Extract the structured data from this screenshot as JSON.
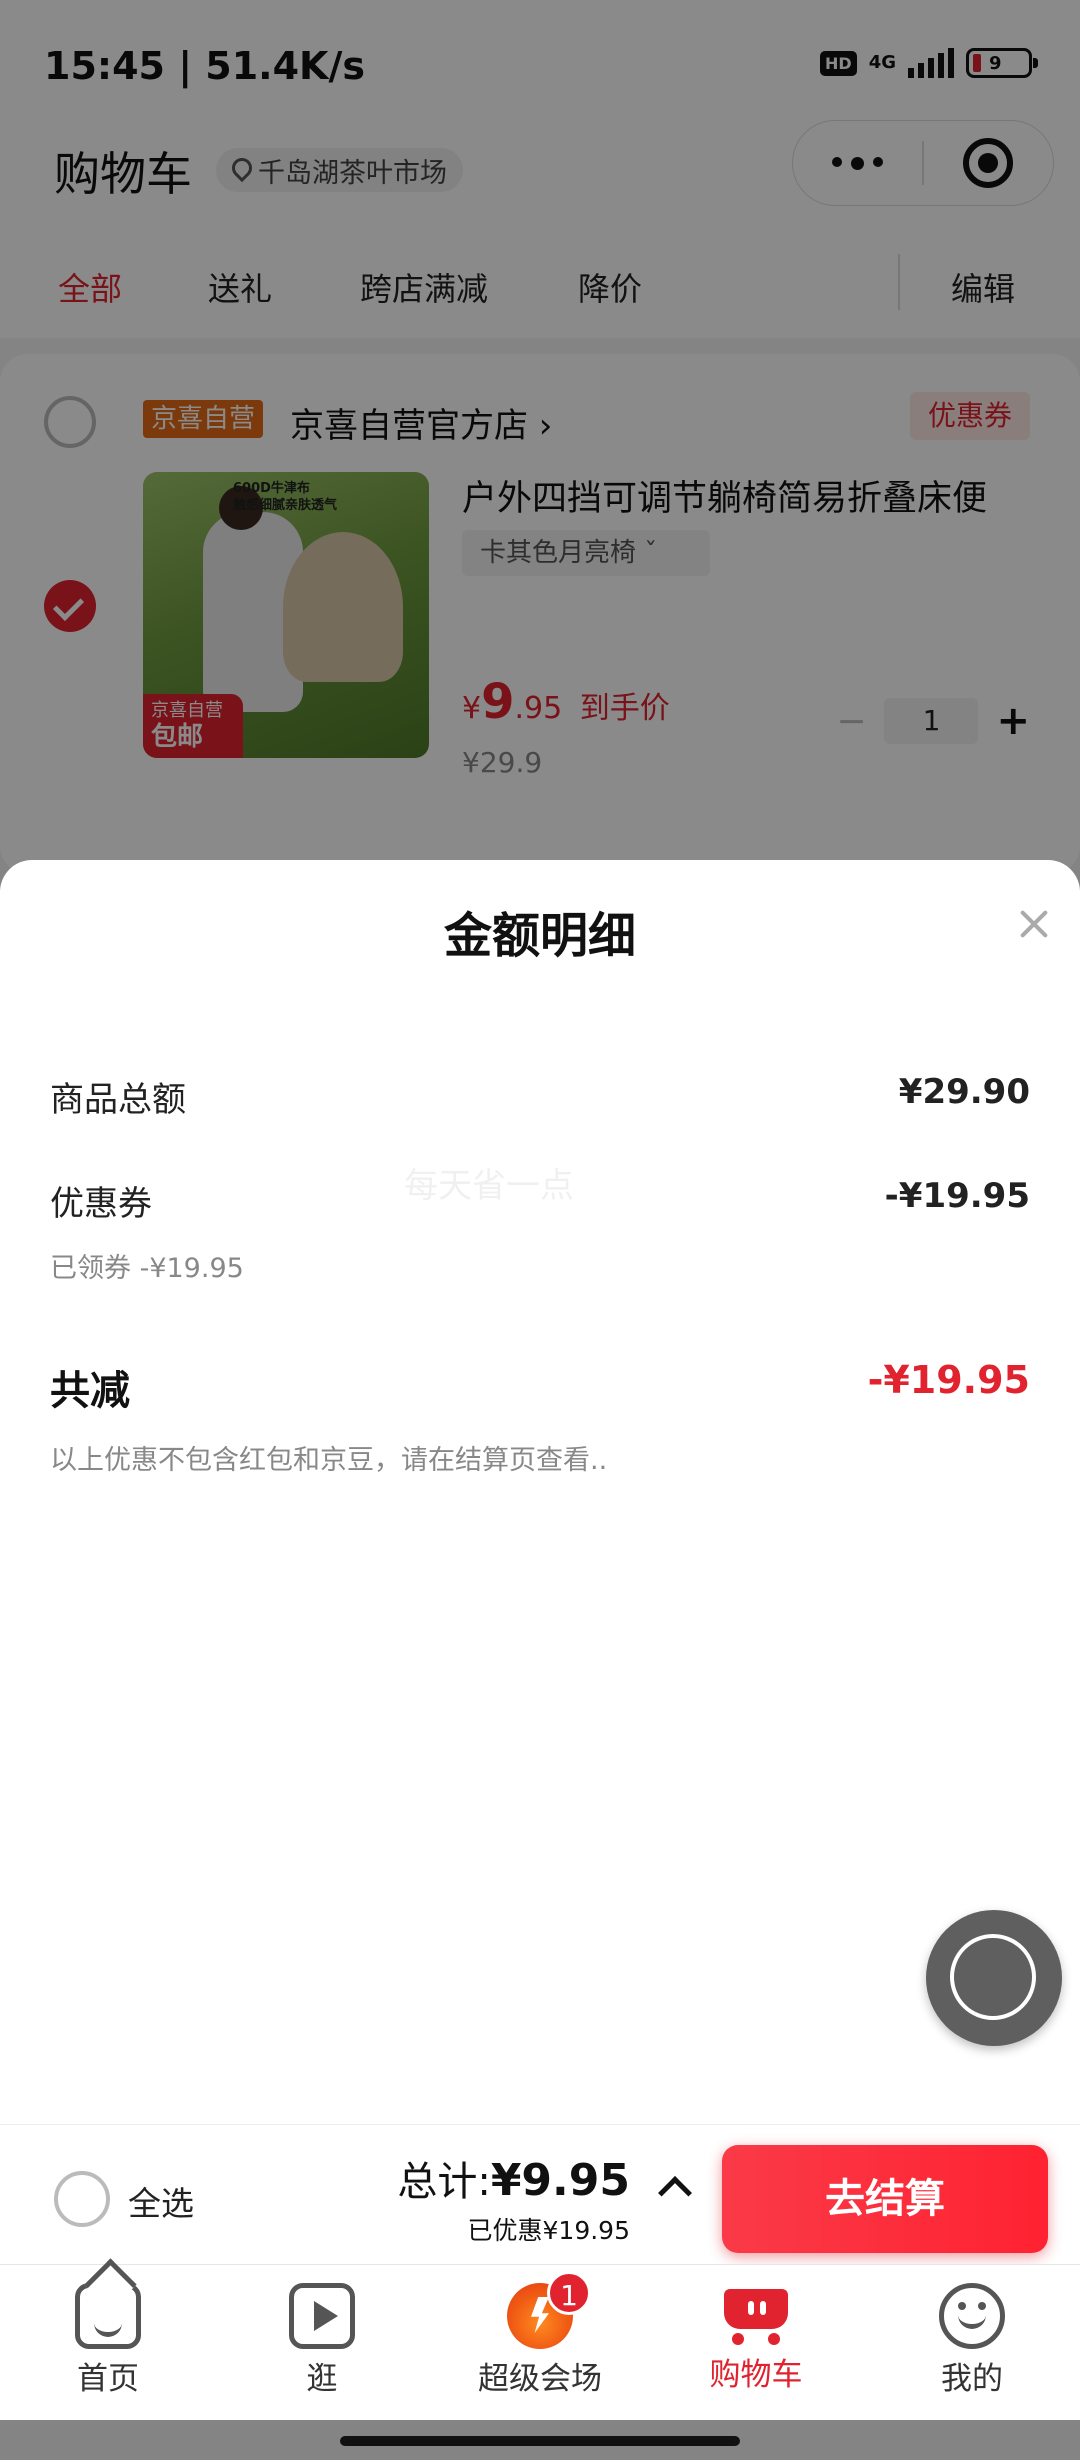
{
  "status_bar": {
    "time": "15:45 | 51.4K/s",
    "hd": "HD",
    "network": "4G",
    "battery": "9"
  },
  "header": {
    "title": "购物车",
    "location": "千岛湖茶叶市场"
  },
  "filter_tabs": [
    {
      "label": "全部",
      "active": true
    },
    {
      "label": "送礼"
    },
    {
      "label": "跨店满减"
    },
    {
      "label": "降价"
    }
  ],
  "edit_label": "编辑",
  "shop": {
    "tag": "京喜自营",
    "name": "京喜自营官方店 ›",
    "coupon_label": "优惠券",
    "product": {
      "title": "户外四挡可调节躺椅简易折叠床便",
      "spec": "卡其色月亮椅  ˇ",
      "img_caption": "600D牛津布\n触感细腻亲肤透气",
      "img_tag_top": "京喜自营",
      "img_tag_bottom": "包邮",
      "price_symbol": "¥",
      "price_int": "9",
      "price_dec": ".95",
      "price_suffix": "到手价",
      "price_old": "¥29.9",
      "quantity": "1",
      "minus": "−",
      "plus": "+"
    }
  },
  "sheet": {
    "title": "金额明细",
    "watermark": "每天省一点",
    "rows": [
      {
        "label": "商品总额",
        "value": "¥29.90"
      },
      {
        "label": "优惠券",
        "value": "-¥19.95",
        "note": "已领券 -¥19.95"
      }
    ],
    "total_label": "共减",
    "total_value": "-¥19.95",
    "disclaimer": "以上优惠不包含红包和京豆，请在结算页查看.."
  },
  "checkout": {
    "select_all": "全选",
    "total_prefix": "总计:",
    "total_amount": "¥9.95",
    "saved": "已优惠¥19.95",
    "button": "去结算"
  },
  "tab_bar": [
    {
      "label": "首页",
      "icon": "home-icon"
    },
    {
      "label": "逛",
      "icon": "video-icon"
    },
    {
      "label": "超级会场",
      "icon": "flame-icon",
      "badge": "1"
    },
    {
      "label": "购物车",
      "icon": "cart-icon",
      "active": true
    },
    {
      "label": "我的",
      "icon": "smiley-icon"
    }
  ],
  "colors": {
    "accent": "#e0232f",
    "orange": "#e66a16"
  }
}
